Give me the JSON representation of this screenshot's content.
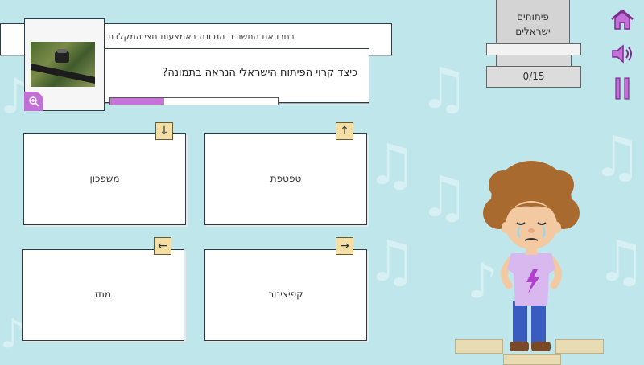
{
  "instruction": "בחרו את התשובה הנכונה באמצעות חצי המקלדת",
  "question": "כיצד קרוי הפיתוח הישראלי הנראה בתמונה?",
  "progress_fraction": 0.32,
  "score_panel": {
    "title_line1": "פיתוחים",
    "title_line2": "ישראלים",
    "counter": "0/15"
  },
  "answers": {
    "top_left": {
      "label": "משפכון",
      "key_icon": "arrow-down-icon"
    },
    "top_right": {
      "label": "טפטפת",
      "key_icon": "arrow-up-icon"
    },
    "bottom_left": {
      "label": "מתז",
      "key_icon": "arrow-left-icon"
    },
    "bottom_right": {
      "label": "קפיצינור",
      "key_icon": "arrow-right-icon"
    }
  },
  "controls": [
    "home-icon",
    "speaker-icon",
    "pause-icon"
  ],
  "colors": {
    "background": "#bfe6ea",
    "accent": "#c26fd8",
    "key": "#f3dfa5"
  }
}
